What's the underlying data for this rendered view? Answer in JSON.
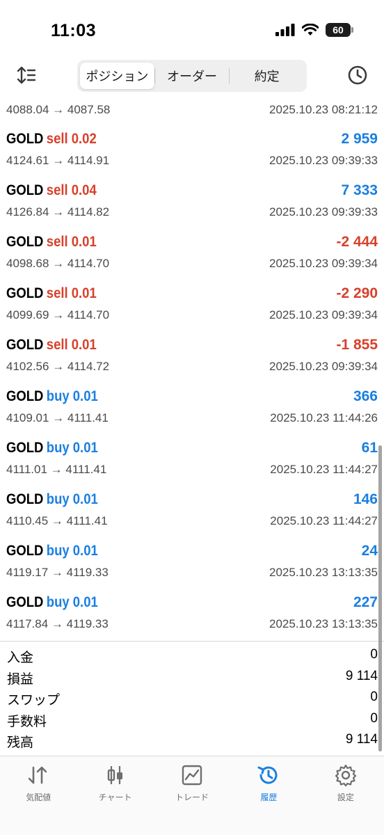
{
  "status_bar": {
    "time": "11:03",
    "battery": "60"
  },
  "tabs": [
    {
      "label": "ポジション",
      "active": true
    },
    {
      "label": "オーダー",
      "active": false
    },
    {
      "label": "約定",
      "active": false
    }
  ],
  "partial_row": {
    "prices": "4088.04 → 4087.58",
    "time": "2025.10.23 08:21:12"
  },
  "deals": [
    {
      "symbol": "GOLD",
      "side": "sell 0.02",
      "type": "sell",
      "profit": "2 959",
      "profit_color": "blue",
      "prices": "4124.61 → 4114.91",
      "time": "2025.10.23 09:39:33"
    },
    {
      "symbol": "GOLD",
      "side": "sell 0.04",
      "type": "sell",
      "profit": "7 333",
      "profit_color": "blue",
      "prices": "4126.84 → 4114.82",
      "time": "2025.10.23 09:39:33"
    },
    {
      "symbol": "GOLD",
      "side": "sell 0.01",
      "type": "sell",
      "profit": "-2 444",
      "profit_color": "red",
      "prices": "4098.68 → 4114.70",
      "time": "2025.10.23 09:39:34"
    },
    {
      "symbol": "GOLD",
      "side": "sell 0.01",
      "type": "sell",
      "profit": "-2 290",
      "profit_color": "red",
      "prices": "4099.69 → 4114.70",
      "time": "2025.10.23 09:39:34"
    },
    {
      "symbol": "GOLD",
      "side": "sell 0.01",
      "type": "sell",
      "profit": "-1 855",
      "profit_color": "red",
      "prices": "4102.56 → 4114.72",
      "time": "2025.10.23 09:39:34"
    },
    {
      "symbol": "GOLD",
      "side": "buy 0.01",
      "type": "buy",
      "profit": "366",
      "profit_color": "blue",
      "prices": "4109.01 → 4111.41",
      "time": "2025.10.23 11:44:26"
    },
    {
      "symbol": "GOLD",
      "side": "buy 0.01",
      "type": "buy",
      "profit": "61",
      "profit_color": "blue",
      "prices": "4111.01 → 4111.41",
      "time": "2025.10.23 11:44:27"
    },
    {
      "symbol": "GOLD",
      "side": "buy 0.01",
      "type": "buy",
      "profit": "146",
      "profit_color": "blue",
      "prices": "4110.45 → 4111.41",
      "time": "2025.10.23 11:44:27"
    },
    {
      "symbol": "GOLD",
      "side": "buy 0.01",
      "type": "buy",
      "profit": "24",
      "profit_color": "blue",
      "prices": "4119.17 → 4119.33",
      "time": "2025.10.23 13:13:35"
    },
    {
      "symbol": "GOLD",
      "side": "buy 0.01",
      "type": "buy",
      "profit": "227",
      "profit_color": "blue",
      "prices": "4117.84 → 4119.33",
      "time": "2025.10.23 13:13:35"
    }
  ],
  "summary": [
    {
      "label": "入金",
      "value": "0"
    },
    {
      "label": "損益",
      "value": "9 114"
    },
    {
      "label": "スワップ",
      "value": "0"
    },
    {
      "label": "手数料",
      "value": "0"
    },
    {
      "label": "残高",
      "value": "9 114"
    }
  ],
  "tabbar": [
    {
      "label": "気配値",
      "icon": "quotes-icon",
      "active": false
    },
    {
      "label": "チャート",
      "icon": "chart-candles-icon",
      "active": false
    },
    {
      "label": "トレード",
      "icon": "trade-icon",
      "active": false
    },
    {
      "label": "履歴",
      "icon": "history-icon",
      "active": true
    },
    {
      "label": "設定",
      "icon": "settings-gear-icon",
      "active": false
    }
  ],
  "colors": {
    "sell": "#d7402a",
    "buy": "#1a7fe0",
    "active_tab": "#1a7fe0"
  }
}
